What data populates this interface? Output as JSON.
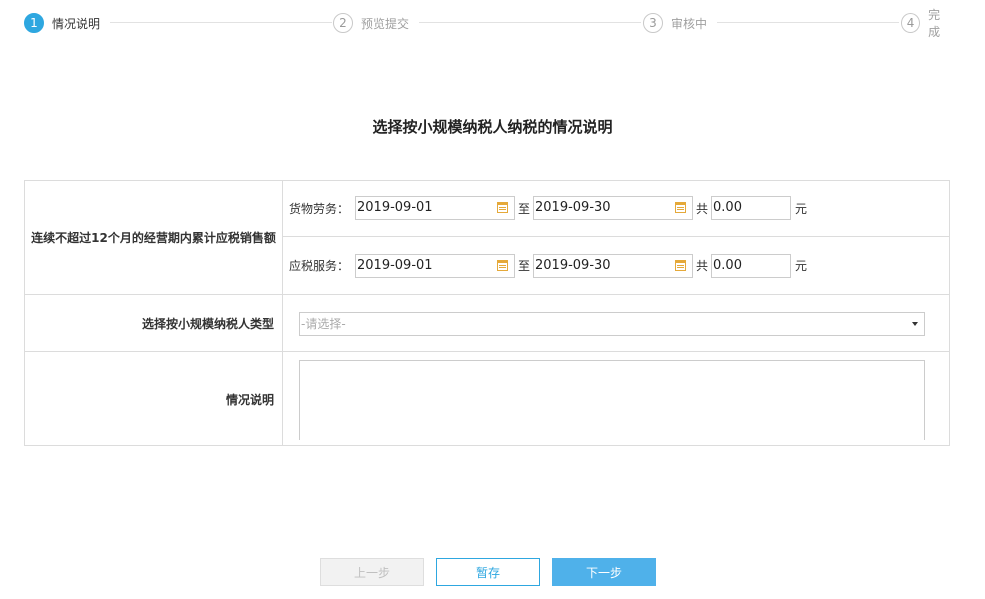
{
  "steps": [
    {
      "num": "1",
      "label": "情况说明",
      "active": true
    },
    {
      "num": "2",
      "label": "预览提交",
      "active": false
    },
    {
      "num": "3",
      "label": "审核中",
      "active": false
    },
    {
      "num": "4",
      "label": "完成",
      "active": false
    }
  ],
  "title": "选择按小规模纳税人纳税的情况说明",
  "sales": {
    "label": "连续不超过12个月的经营期内累计应税销售额",
    "goods": {
      "label": "货物劳务：",
      "start": "2019-09-01",
      "end": "2019-09-30",
      "to": "至",
      "total": "共",
      "amount": "0.00",
      "unit": "元"
    },
    "services": {
      "label": "应税服务：",
      "start": "2019-09-01",
      "end": "2019-09-30",
      "to": "至",
      "total": "共",
      "amount": "0.00",
      "unit": "元"
    }
  },
  "type_row": {
    "label": "选择按小规模纳税人类型",
    "placeholder": "-请选择-"
  },
  "desc_row": {
    "label": "情况说明"
  },
  "buttons": {
    "prev": "上一步",
    "save": "暂存",
    "next": "下一步"
  },
  "colors": {
    "accent": "#2ea7e0",
    "next_button": "#4fb1ea",
    "calendar_icon": "#e5a93a"
  }
}
